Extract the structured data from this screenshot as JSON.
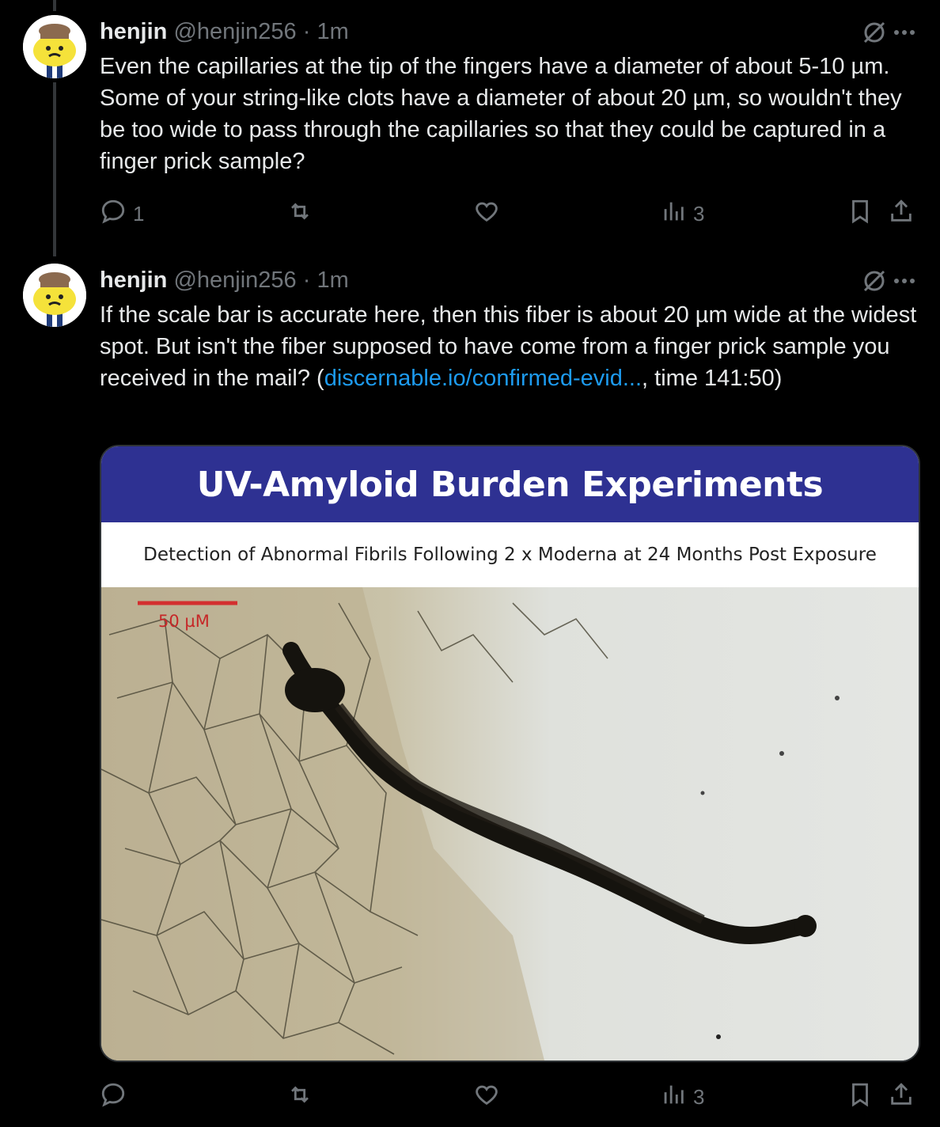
{
  "tweets": [
    {
      "name": "henjin",
      "handle": "@henjin256",
      "separator": "·",
      "time": "1m",
      "text": "Even the capillaries at the tip of the fingers have a diameter of about 5-10 µm. Some of your string-like clots have a diameter of about 20 µm, so wouldn't they be too wide to pass through the capillaries so that they could be captured in a finger prick sample?",
      "reply_count": "1",
      "retweet_count": "",
      "like_count": "",
      "view_count": "3"
    },
    {
      "name": "henjin",
      "handle": "@henjin256",
      "separator": "·",
      "time": "1m",
      "text_before": "If the scale bar is accurate here, then this fiber is about 20 µm wide at the widest spot. But isn't the fiber supposed to have come from a finger prick sample you received in the mail? (",
      "link": "discernable.io/confirmed-evid...",
      "text_after": ", time 141:50)",
      "reply_count": "",
      "retweet_count": "",
      "like_count": "",
      "view_count": "3",
      "media": {
        "title": "UV-Amyloid Burden Experiments",
        "subtitle": "Detection of Abnormal Fibrils Following 2 x Moderna at 24 Months Post Exposure",
        "scale_label": "50 µM"
      }
    }
  ],
  "colors": {
    "background": "#000000",
    "text": "#e7e9ea",
    "muted": "#71767b",
    "link": "#1d9bf0",
    "slide_header": "#2e3192",
    "scale_bar": "#d32f2f"
  },
  "icons": [
    "grok-slash-icon",
    "more-icon",
    "reply-icon",
    "retweet-icon",
    "like-icon",
    "views-icon",
    "bookmark-icon",
    "share-icon"
  ]
}
